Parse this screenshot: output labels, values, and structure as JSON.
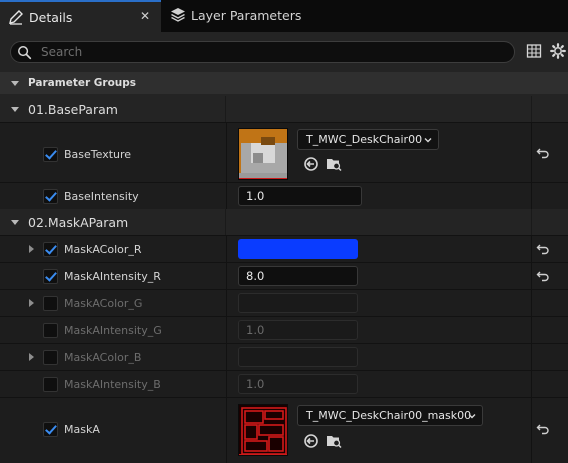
{
  "tabs": [
    {
      "label": "Details",
      "icon": "details-pencil-icon",
      "active": true
    },
    {
      "label": "Layer Parameters",
      "icon": "layers-icon",
      "active": false
    }
  ],
  "close_glyph": "✕",
  "search": {
    "placeholder": "Search"
  },
  "toolbar": {
    "icons": [
      "grid-view-icon",
      "settings-gear-icon"
    ]
  },
  "parameter_groups_label": "Parameter Groups",
  "groups": [
    {
      "label": "01.BaseParam",
      "params": [
        {
          "name": "BaseTexture",
          "checked": true,
          "type": "texture",
          "asset": "T_MWC_DeskChair00",
          "resettable": true
        },
        {
          "name": "BaseIntensity",
          "checked": true,
          "type": "scalar",
          "value": "1.0",
          "resettable": false
        }
      ]
    },
    {
      "label": "02.MaskAParam",
      "params": [
        {
          "name": "MaskAColor_R",
          "checked": true,
          "type": "color",
          "color": "#0a3cff",
          "expandable": true,
          "resettable": true
        },
        {
          "name": "MaskAIntensity_R",
          "checked": true,
          "type": "scalar",
          "value": "8.0",
          "resettable": true
        },
        {
          "name": "MaskAColor_G",
          "checked": false,
          "type": "color",
          "expandable": true,
          "resettable": false
        },
        {
          "name": "MaskAIntensity_G",
          "checked": false,
          "type": "scalar",
          "value": "1.0",
          "resettable": false
        },
        {
          "name": "MaskAColor_B",
          "checked": false,
          "type": "color",
          "expandable": true,
          "resettable": false
        },
        {
          "name": "MaskAIntensity_B",
          "checked": false,
          "type": "scalar",
          "value": "1.0",
          "resettable": false
        },
        {
          "name": "MaskA",
          "checked": true,
          "type": "texture",
          "asset": "T_MWC_DeskChair00_mask00",
          "resettable": true
        }
      ]
    }
  ],
  "colors": {
    "accent": "#2a6fc9",
    "checkmark": "#3a8cf0",
    "mask_color_r": "#0a3cff"
  }
}
